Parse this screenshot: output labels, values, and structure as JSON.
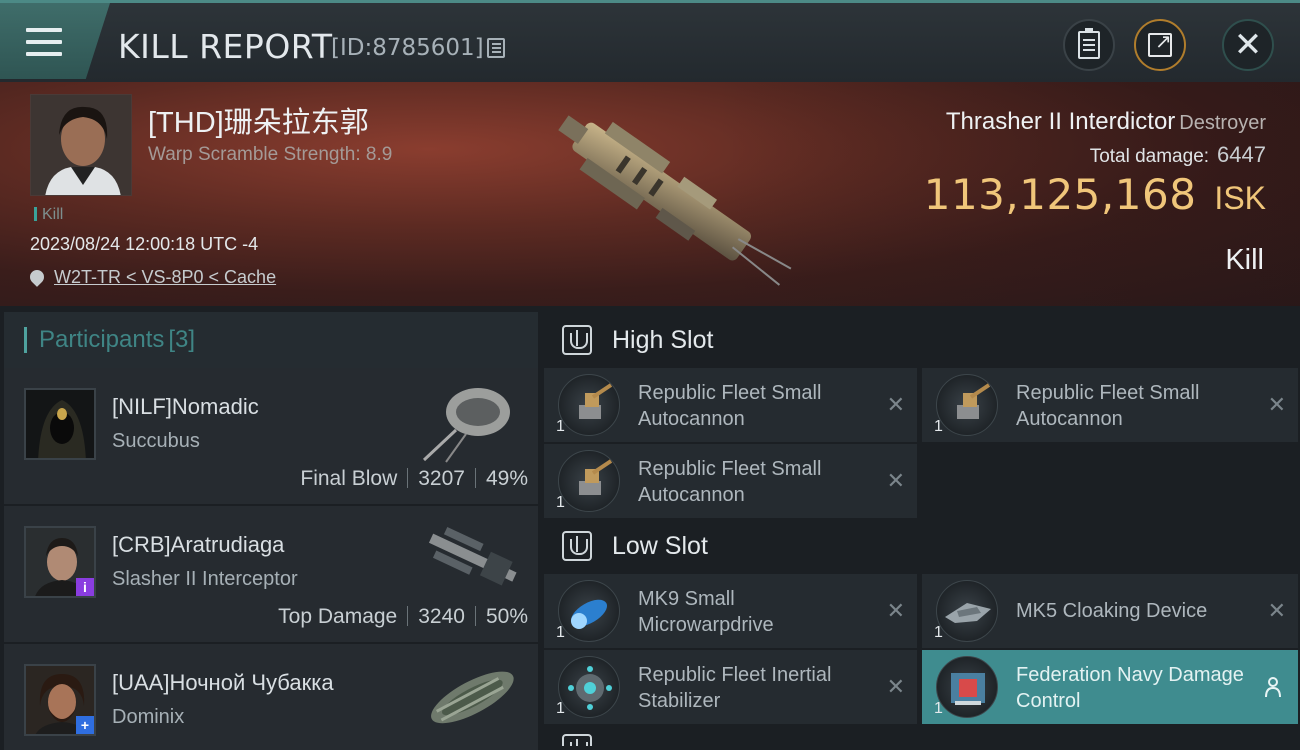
{
  "header": {
    "title": "KILL REPORT",
    "report_id": "[ID:8785601]"
  },
  "victim": {
    "name": "[THD]珊朵拉东郭",
    "scramble": "Warp Scramble Strength: 8.9",
    "tag": "Kill",
    "time": "2023/08/24 12:00:18 UTC -4",
    "location": "W2T-TR < VS-8P0 < Cache"
  },
  "ship": {
    "name": "Thrasher II Interdictor",
    "class": "Destroyer",
    "total_damage_label": "Total damage:",
    "total_damage": "6447",
    "isk_value": "113,125,168",
    "isk_unit": "ISK",
    "result": "Kill"
  },
  "participants": {
    "label": "Participants",
    "count": "[3]",
    "items": [
      {
        "name": "[NILF]Nomadic",
        "ship": "Succubus",
        "role": "Final Blow",
        "damage": "3207",
        "percent": "49%",
        "badge": ""
      },
      {
        "name": "[CRB]Aratrudiaga",
        "ship": "Slasher II Interceptor",
        "role": "Top Damage",
        "damage": "3240",
        "percent": "50%",
        "badge": "i"
      },
      {
        "name": "[UAA]Ночной Чубакка",
        "ship": "Dominix",
        "role": "",
        "damage": "",
        "percent": "",
        "badge": "+"
      }
    ]
  },
  "high_slot": {
    "title": "High Slot",
    "modules": [
      {
        "name": "Republic Fleet Small Autocannon",
        "qty": "1"
      },
      {
        "name": "Republic Fleet Small Autocannon",
        "qty": "1"
      },
      {
        "name": "Republic Fleet Small Autocannon",
        "qty": "1"
      }
    ]
  },
  "low_slot": {
    "title": "Low Slot",
    "modules": [
      {
        "name": "MK9 Small Microwarpdrive",
        "qty": "1"
      },
      {
        "name": "MK5 Cloaking Device",
        "qty": "1"
      },
      {
        "name": "Republic Fleet Inertial Stabilizer",
        "qty": "1"
      },
      {
        "name": "Federation Navy Damage Control",
        "qty": "1"
      }
    ]
  },
  "colors": {
    "accent": "#3f8c8f",
    "isk": "#f0c67a",
    "hero_red": "#5c2a22"
  }
}
